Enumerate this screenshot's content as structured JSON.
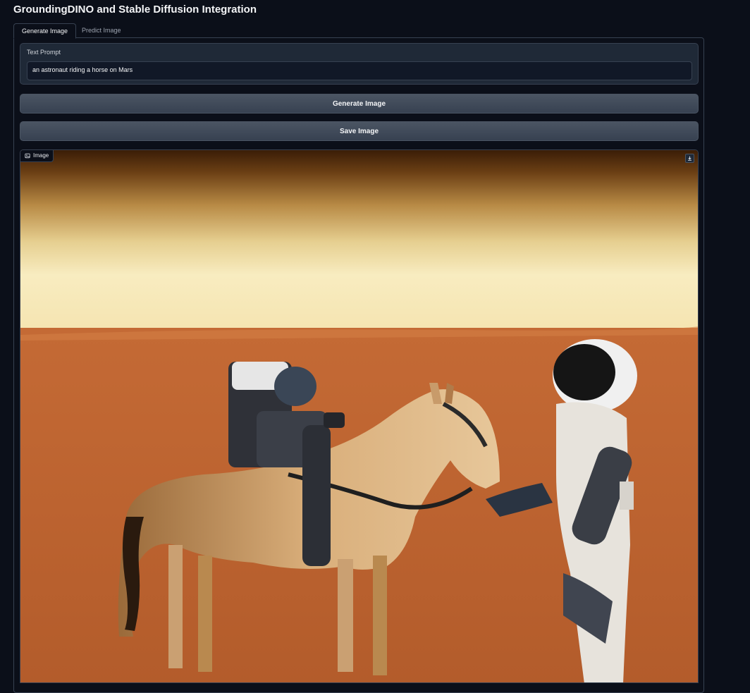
{
  "app": {
    "title": "GroundingDINO and Stable Diffusion Integration"
  },
  "tabs": [
    {
      "label": "Generate Image",
      "active": true
    },
    {
      "label": "Predict Image",
      "active": false
    }
  ],
  "prompt": {
    "label": "Text Prompt",
    "value": "an astronaut riding a horse on Mars"
  },
  "buttons": {
    "generate": "Generate Image",
    "save": "Save Image"
  },
  "image_output": {
    "label": "Image",
    "label_icon": "image-icon",
    "download_icon": "download-icon"
  },
  "colors": {
    "background": "#0b0f19",
    "panel": "#1f2937",
    "button": "#374151",
    "border": "#374151"
  }
}
